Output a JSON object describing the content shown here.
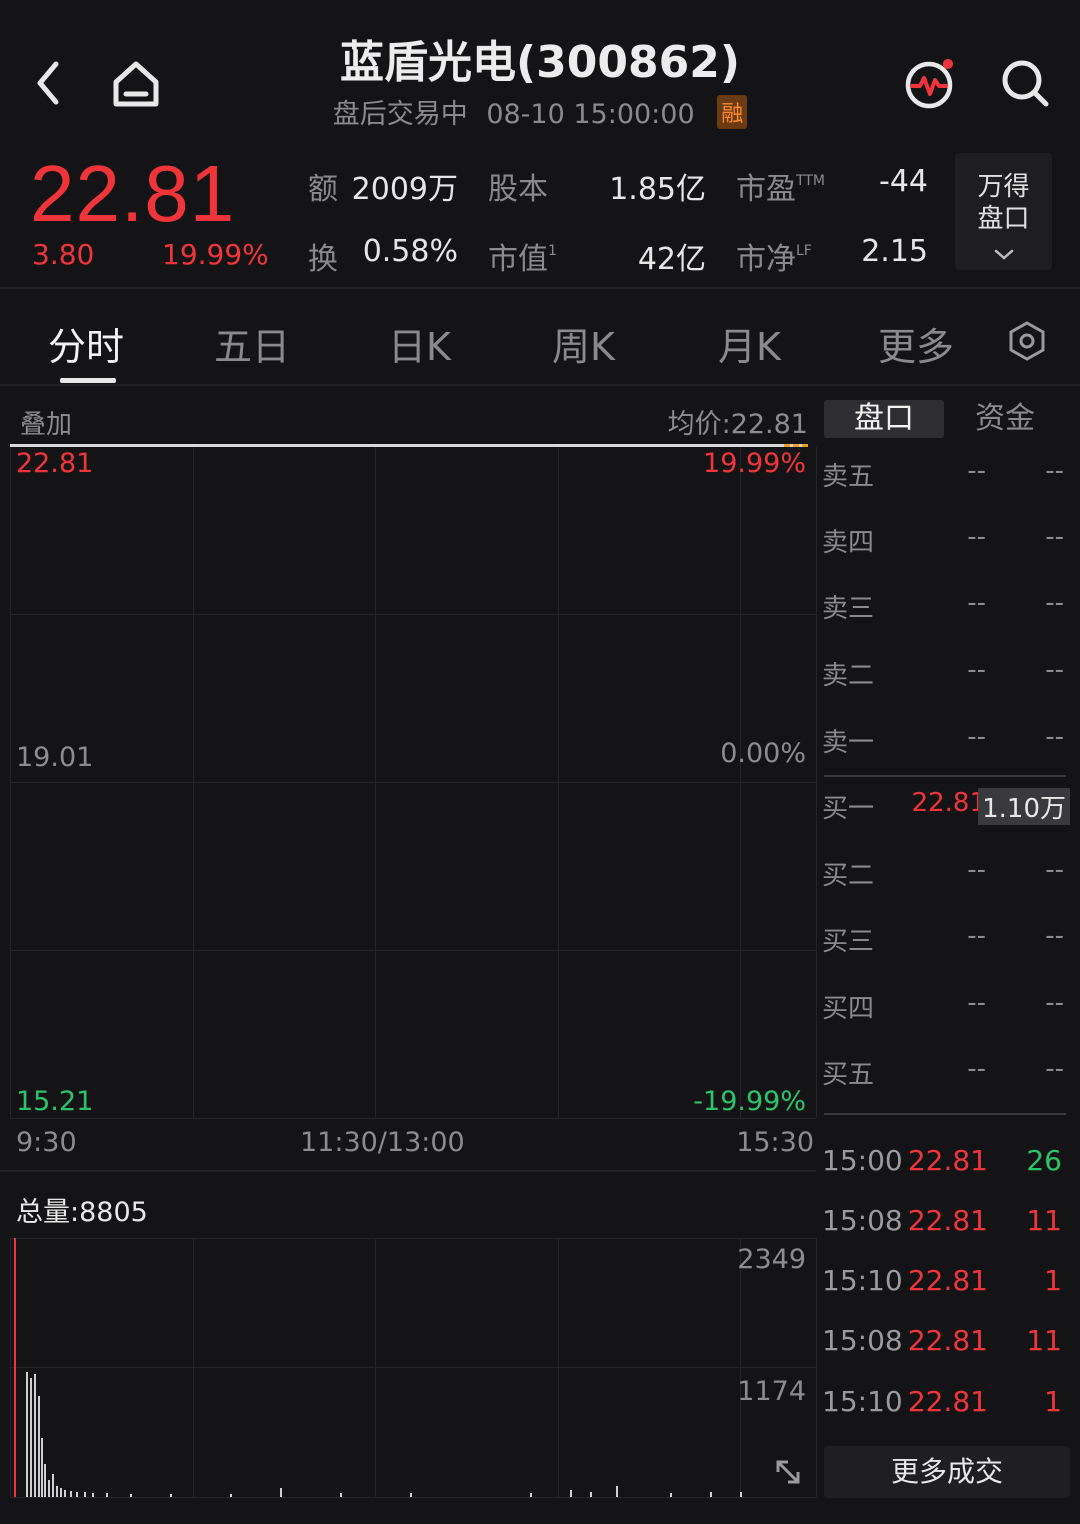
{
  "header": {
    "title": "蓝盾光电(300862)",
    "status": "盘后交易中",
    "datetime": "08-10 15:00:00",
    "badge": "融"
  },
  "quote": {
    "price": "22.81",
    "change": "3.80",
    "change_pct": "19.99%",
    "amount_label": "额",
    "amount_value": "2009万",
    "turnover_label": "换",
    "turnover_value": "0.58%",
    "share_cap_label": "股本",
    "share_cap_value": "1.85亿",
    "mkt_val_label": "市值",
    "mkt_val_sup": "1",
    "mkt_val_value": "42亿",
    "pe_label": "市盈",
    "pe_sup": "TTM",
    "pe_value": "-44",
    "pb_label": "市净",
    "pb_sup": "LF",
    "pb_value": "2.15",
    "wind_btn_line1": "万得",
    "wind_btn_line2": "盘口"
  },
  "tabs": [
    "分时",
    "五日",
    "日K",
    "周K",
    "月K",
    "更多"
  ],
  "chart": {
    "overlay_label": "叠加",
    "avg_price_label": "均价:22.81",
    "y_top": "22.81",
    "y_mid": "19.01",
    "y_bottom": "15.21",
    "pct_top": "19.99%",
    "pct_mid": "0.00%",
    "pct_bottom": "-19.99%",
    "x_start": "9:30",
    "x_mid": "11:30/13:00",
    "x_end": "15:30",
    "volume_label": "总量:8805",
    "vol_top": "2349",
    "vol_mid": "1174"
  },
  "orderbook": {
    "tab_active": "盘口",
    "tab_other": "资金",
    "asks": [
      {
        "name": "卖五",
        "price": "--",
        "vol": "--"
      },
      {
        "name": "卖四",
        "price": "--",
        "vol": "--"
      },
      {
        "name": "卖三",
        "price": "--",
        "vol": "--"
      },
      {
        "name": "卖二",
        "price": "--",
        "vol": "--"
      },
      {
        "name": "卖一",
        "price": "--",
        "vol": "--"
      }
    ],
    "bids": [
      {
        "name": "买一",
        "price": "22.81",
        "vol": "1.10万"
      },
      {
        "name": "买二",
        "price": "--",
        "vol": "--"
      },
      {
        "name": "买三",
        "price": "--",
        "vol": "--"
      },
      {
        "name": "买四",
        "price": "--",
        "vol": "--"
      },
      {
        "name": "买五",
        "price": "--",
        "vol": "--"
      }
    ]
  },
  "trades": [
    {
      "time": "15:00",
      "price": "22.81",
      "vol": "26",
      "side": "buy"
    },
    {
      "time": "15:08",
      "price": "22.81",
      "vol": "11",
      "side": "sell"
    },
    {
      "time": "15:10",
      "price": "22.81",
      "vol": "1",
      "side": "sell"
    },
    {
      "time": "15:08",
      "price": "22.81",
      "vol": "11",
      "side": "sell"
    },
    {
      "time": "15:10",
      "price": "22.81",
      "vol": "1",
      "side": "sell"
    }
  ],
  "more_trades_label": "更多成交",
  "colors": {
    "up": "#f0353a",
    "down": "#2bc46a",
    "background": "#141416"
  }
}
